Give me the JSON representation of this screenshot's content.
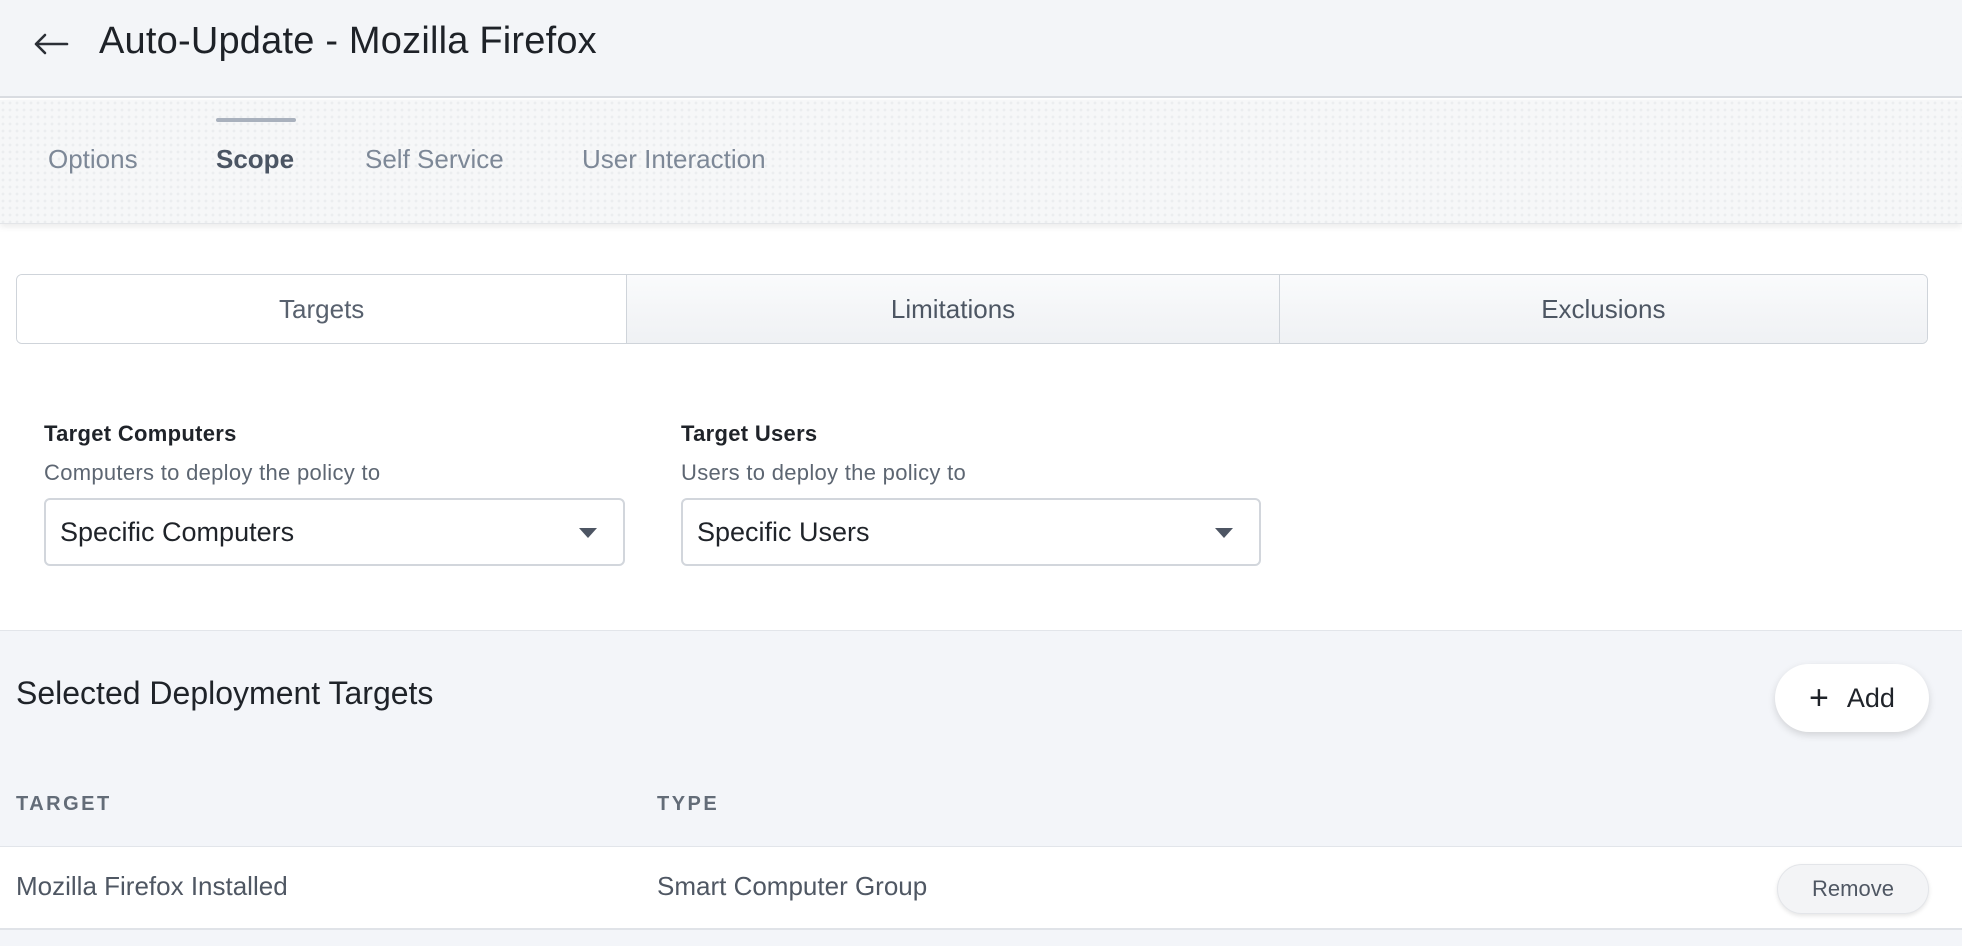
{
  "header": {
    "back_icon": "arrow-left-icon",
    "title": "Auto-Update - Mozilla Firefox"
  },
  "tabs": [
    {
      "label": "Options",
      "active": false
    },
    {
      "label": "Scope",
      "active": true
    },
    {
      "label": "Self Service",
      "active": false
    },
    {
      "label": "User Interaction",
      "active": false
    }
  ],
  "scope_segments": [
    {
      "label": "Targets",
      "active": true
    },
    {
      "label": "Limitations",
      "active": false
    },
    {
      "label": "Exclusions",
      "active": false
    }
  ],
  "target_computers": {
    "title": "Target Computers",
    "description": "Computers to deploy the policy to",
    "value": "Specific Computers"
  },
  "target_users": {
    "title": "Target Users",
    "description": "Users to deploy the policy to",
    "value": "Specific Users"
  },
  "deployment_targets": {
    "title": "Selected Deployment Targets",
    "add_label": "Add",
    "add_icon": "plus-icon",
    "columns": [
      "TARGET",
      "TYPE"
    ],
    "rows": [
      {
        "target": "Mozilla Firefox Installed",
        "type": "Smart Computer Group",
        "action": "Remove"
      }
    ]
  },
  "colors": {
    "header_bg": "#f3f5f8",
    "section_bg": "#f3f5f9",
    "active_tab": "#4b5563",
    "inactive_tab": "#7d8897"
  }
}
